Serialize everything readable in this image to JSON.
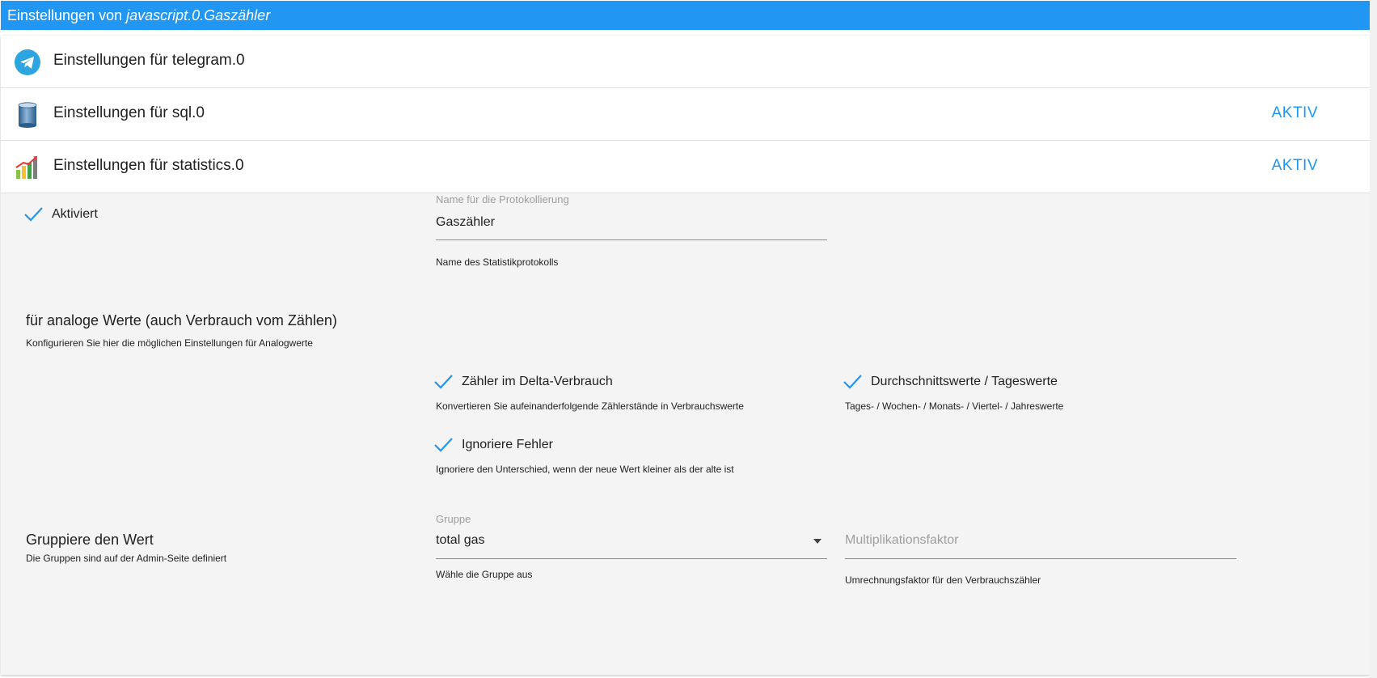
{
  "titlebar": {
    "prefix": "Einstellungen von ",
    "object": "javascript.0.Gaszähler"
  },
  "adapters": [
    {
      "label": "Einstellungen für telegram.0",
      "status": "",
      "icon": "telegram-icon"
    },
    {
      "label": "Einstellungen für sql.0",
      "status": "AKTIV",
      "icon": "database-icon"
    },
    {
      "label": "Einstellungen für statistics.0",
      "status": "AKTIV",
      "icon": "statistics-chart-icon"
    }
  ],
  "statistics": {
    "enabled": {
      "label": "Aktiviert",
      "checked": true
    },
    "log_name": {
      "label": "Name für die Protokollierung",
      "value": "Gaszähler",
      "hint": "Name des Statistikprotokolls"
    },
    "analog": {
      "heading": "für analoge Werte (auch Verbrauch vom Zählen)",
      "subheading": "Konfigurieren Sie hier die möglichen Einstellungen für Analogwerte",
      "delta": {
        "label": "Zähler im Delta-Verbrauch",
        "hint": "Konvertieren Sie aufeinanderfolgende Zählerstände in Verbrauchswerte",
        "checked": true
      },
      "averages": {
        "label": "Durchschnittswerte / Tageswerte",
        "hint": "Tages- / Wochen- / Monats- / Viertel- / Jahreswerte",
        "checked": true
      },
      "ignore_errors": {
        "label": "Ignoriere Fehler",
        "hint": "Ignoriere den Unterschied, wenn der neue Wert kleiner als der alte ist",
        "checked": true
      }
    },
    "group": {
      "heading": "Gruppiere den Wert",
      "subheading": "Die Gruppen sind auf der Admin-Seite definiert",
      "select_label": "Gruppe",
      "select_value": "total gas",
      "select_hint": "Wähle die Gruppe aus",
      "factor_placeholder": "Multiplikationsfaktor",
      "factor_hint": "Umrechnungsfaktor für den Verbrauchszähler"
    }
  },
  "colors": {
    "accent": "#2196f3",
    "panel_bg": "#f4f4f4",
    "check": "#2196f3"
  }
}
